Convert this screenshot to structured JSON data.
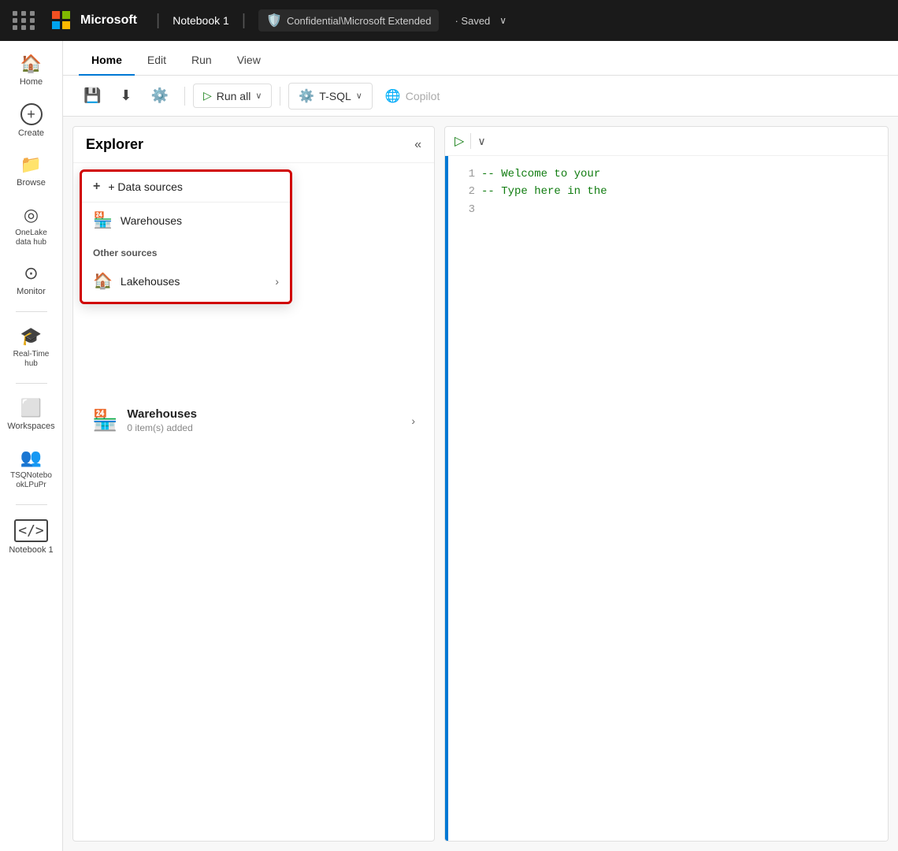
{
  "topbar": {
    "notebook_name": "Notebook 1",
    "confidential_label": "Confidential\\Microsoft Extended",
    "saved_label": "· Saved",
    "chevron": "∨"
  },
  "tabs": {
    "items": [
      {
        "label": "Home",
        "active": true
      },
      {
        "label": "Edit",
        "active": false
      },
      {
        "label": "Run",
        "active": false
      },
      {
        "label": "View",
        "active": false
      }
    ]
  },
  "toolbar": {
    "run_all": "Run all",
    "tsql": "T-SQL",
    "copilot": "Copilot"
  },
  "explorer": {
    "title": "Explorer",
    "collapse_icon": "«",
    "dropdown": {
      "add_data_sources": "+ Data sources",
      "warehouses_label": "Warehouses",
      "other_sources": "Other sources",
      "lakehouses_label": "Lakehouses"
    },
    "list_items": [
      {
        "name": "Warehouses",
        "sub": "0 item(s) added"
      }
    ]
  },
  "code_editor": {
    "lines": [
      "1",
      "2",
      "3"
    ],
    "code": [
      "-- Welcome to your",
      "-- Type here in the",
      ""
    ]
  },
  "sidebar_nav": {
    "items": [
      {
        "label": "Home",
        "icon": "🏠"
      },
      {
        "label": "Create",
        "icon": "⊕"
      },
      {
        "label": "Browse",
        "icon": "📁"
      },
      {
        "label": "OneLake\ndata hub",
        "icon": "◎"
      },
      {
        "label": "Monitor",
        "icon": "◎"
      },
      {
        "label": "Real-Time\nhub",
        "icon": "🎓"
      },
      {
        "label": "Workspaces",
        "icon": "□"
      },
      {
        "label": "TSQNotebo\nokLPuPr",
        "icon": "👥"
      },
      {
        "label": "Notebook 1",
        "icon": "</>"
      }
    ]
  }
}
